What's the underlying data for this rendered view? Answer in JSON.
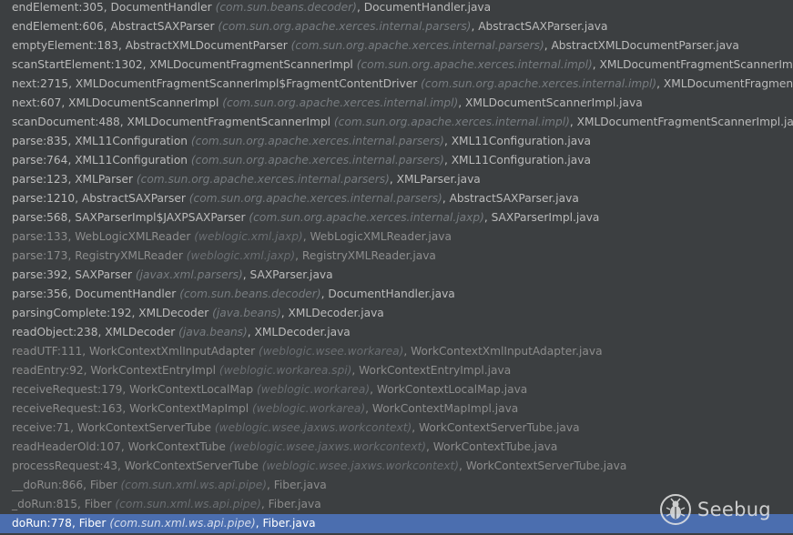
{
  "frames": [
    {
      "method": "endElement:305",
      "cls": "DocumentHandler",
      "pkg": "(com.sun.beans.decoder)",
      "file": "DocumentHandler.java",
      "lib": false
    },
    {
      "method": "endElement:606",
      "cls": "AbstractSAXParser",
      "pkg": "(com.sun.org.apache.xerces.internal.parsers)",
      "file": "AbstractSAXParser.java",
      "lib": false
    },
    {
      "method": "emptyElement:183",
      "cls": "AbstractXMLDocumentParser",
      "pkg": "(com.sun.org.apache.xerces.internal.parsers)",
      "file": "AbstractXMLDocumentParser.java",
      "lib": false
    },
    {
      "method": "scanStartElement:1302",
      "cls": "XMLDocumentFragmentScannerImpl",
      "pkg": "(com.sun.org.apache.xerces.internal.impl)",
      "file": "XMLDocumentFragmentScannerImpl.java",
      "lib": false
    },
    {
      "method": "next:2715",
      "cls": "XMLDocumentFragmentScannerImpl$FragmentContentDriver",
      "pkg": "(com.sun.org.apache.xerces.internal.impl)",
      "file": "XMLDocumentFragmentScannerImpl.java",
      "lib": false
    },
    {
      "method": "next:607",
      "cls": "XMLDocumentScannerImpl",
      "pkg": "(com.sun.org.apache.xerces.internal.impl)",
      "file": "XMLDocumentScannerImpl.java",
      "lib": false
    },
    {
      "method": "scanDocument:488",
      "cls": "XMLDocumentFragmentScannerImpl",
      "pkg": "(com.sun.org.apache.xerces.internal.impl)",
      "file": "XMLDocumentFragmentScannerImpl.java",
      "lib": false
    },
    {
      "method": "parse:835",
      "cls": "XML11Configuration",
      "pkg": "(com.sun.org.apache.xerces.internal.parsers)",
      "file": "XML11Configuration.java",
      "lib": false
    },
    {
      "method": "parse:764",
      "cls": "XML11Configuration",
      "pkg": "(com.sun.org.apache.xerces.internal.parsers)",
      "file": "XML11Configuration.java",
      "lib": false
    },
    {
      "method": "parse:123",
      "cls": "XMLParser",
      "pkg": "(com.sun.org.apache.xerces.internal.parsers)",
      "file": "XMLParser.java",
      "lib": false
    },
    {
      "method": "parse:1210",
      "cls": "AbstractSAXParser",
      "pkg": "(com.sun.org.apache.xerces.internal.parsers)",
      "file": "AbstractSAXParser.java",
      "lib": false
    },
    {
      "method": "parse:568",
      "cls": "SAXParserImpl$JAXPSAXParser",
      "pkg": "(com.sun.org.apache.xerces.internal.jaxp)",
      "file": "SAXParserImpl.java",
      "lib": false
    },
    {
      "method": "parse:133",
      "cls": "WebLogicXMLReader",
      "pkg": "(weblogic.xml.jaxp)",
      "file": "WebLogicXMLReader.java",
      "lib": true
    },
    {
      "method": "parse:173",
      "cls": "RegistryXMLReader",
      "pkg": "(weblogic.xml.jaxp)",
      "file": "RegistryXMLReader.java",
      "lib": true
    },
    {
      "method": "parse:392",
      "cls": "SAXParser",
      "pkg": "(javax.xml.parsers)",
      "file": "SAXParser.java",
      "lib": false
    },
    {
      "method": "parse:356",
      "cls": "DocumentHandler",
      "pkg": "(com.sun.beans.decoder)",
      "file": "DocumentHandler.java",
      "lib": false
    },
    {
      "method": "parsingComplete:192",
      "cls": "XMLDecoder",
      "pkg": "(java.beans)",
      "file": "XMLDecoder.java",
      "lib": false
    },
    {
      "method": "readObject:238",
      "cls": "XMLDecoder",
      "pkg": "(java.beans)",
      "file": "XMLDecoder.java",
      "lib": false
    },
    {
      "method": "readUTF:111",
      "cls": "WorkContextXmlInputAdapter",
      "pkg": "(weblogic.wsee.workarea)",
      "file": "WorkContextXmlInputAdapter.java",
      "lib": true
    },
    {
      "method": "readEntry:92",
      "cls": "WorkContextEntryImpl",
      "pkg": "(weblogic.workarea.spi)",
      "file": "WorkContextEntryImpl.java",
      "lib": true
    },
    {
      "method": "receiveRequest:179",
      "cls": "WorkContextLocalMap",
      "pkg": "(weblogic.workarea)",
      "file": "WorkContextLocalMap.java",
      "lib": true
    },
    {
      "method": "receiveRequest:163",
      "cls": "WorkContextMapImpl",
      "pkg": "(weblogic.workarea)",
      "file": "WorkContextMapImpl.java",
      "lib": true
    },
    {
      "method": "receive:71",
      "cls": "WorkContextServerTube",
      "pkg": "(weblogic.wsee.jaxws.workcontext)",
      "file": "WorkContextServerTube.java",
      "lib": true
    },
    {
      "method": "readHeaderOld:107",
      "cls": "WorkContextTube",
      "pkg": "(weblogic.wsee.jaxws.workcontext)",
      "file": "WorkContextTube.java",
      "lib": true
    },
    {
      "method": "processRequest:43",
      "cls": "WorkContextServerTube",
      "pkg": "(weblogic.wsee.jaxws.workcontext)",
      "file": "WorkContextServerTube.java",
      "lib": true
    },
    {
      "method": "__doRun:866",
      "cls": "Fiber",
      "pkg": "(com.sun.xml.ws.api.pipe)",
      "file": "Fiber.java",
      "lib": true
    },
    {
      "method": "_doRun:815",
      "cls": "Fiber",
      "pkg": "(com.sun.xml.ws.api.pipe)",
      "file": "Fiber.java",
      "lib": true
    },
    {
      "method": "doRun:778",
      "cls": "Fiber",
      "pkg": "(com.sun.xml.ws.api.pipe)",
      "file": "Fiber.java",
      "lib": true
    }
  ],
  "selected_index": 27,
  "watermark": {
    "text": "Seebug",
    "icon": "seebug-bug-icon"
  },
  "colors": {
    "background": "#3c3f41",
    "text": "#bbbbbb",
    "library_text": "#8c8c8c",
    "package_text": "#777c80",
    "selection": "#4b6eaf"
  }
}
